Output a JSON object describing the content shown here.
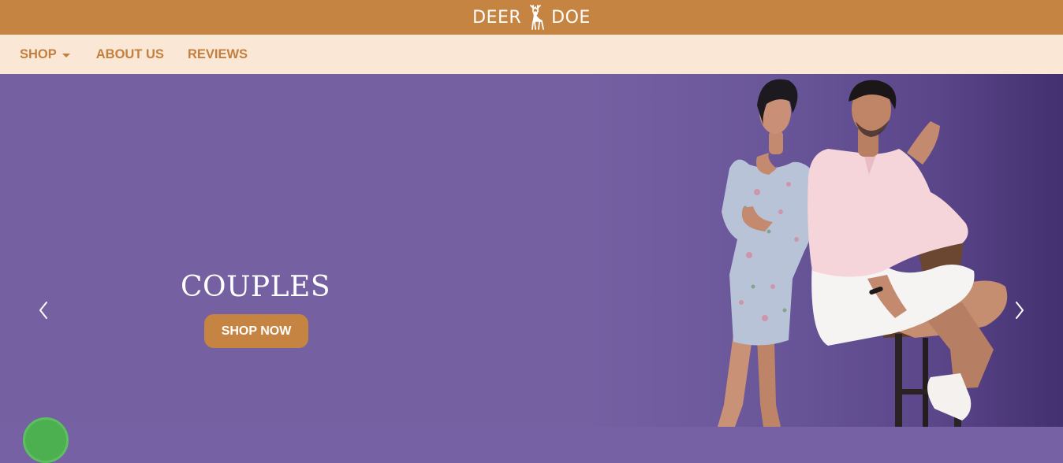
{
  "brand": {
    "name_left": "DEER",
    "name_right": "DOE",
    "logo_icon": "deer-icon"
  },
  "nav": {
    "items": [
      {
        "label": "SHOP",
        "has_dropdown": true
      },
      {
        "label": "ABOUT US"
      },
      {
        "label": "REVIEWS"
      }
    ]
  },
  "hero": {
    "title": "COUPLES",
    "cta_label": "SHOP NOW",
    "prev_icon": "chevron-left-icon",
    "next_icon": "chevron-right-icon",
    "image": "couple-photo"
  },
  "chat": {
    "icon": "chat-icon"
  },
  "colors": {
    "accent": "#c68443",
    "nav_bg": "#fbe7d6",
    "nav_text": "#c1803f",
    "hero_bg": "#7561a3"
  }
}
